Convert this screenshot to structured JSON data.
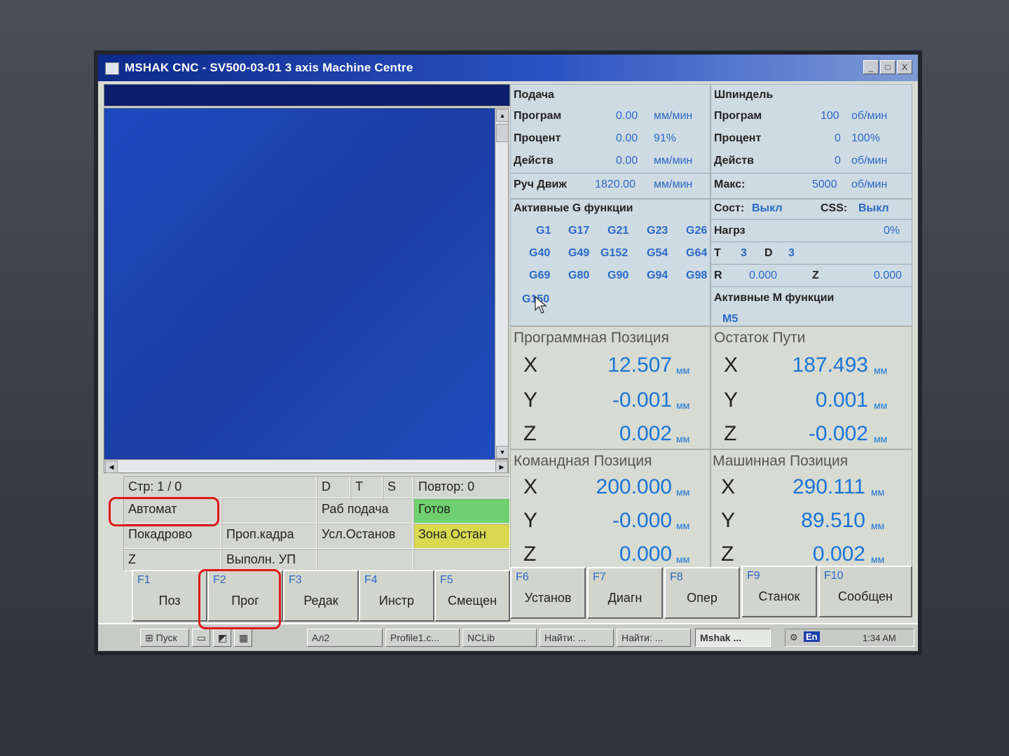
{
  "window": {
    "title": "MSHAK CNC - SV500-03-01 3 axis Machine Centre",
    "buttons": [
      "_",
      "□",
      "X"
    ]
  },
  "status": {
    "page": "Стр: 1 / 0",
    "d": "D",
    "t": "T",
    "s": "S",
    "repeat": "Повтор:  0",
    "mode": "Автомат",
    "feed_mode": "Раб подача",
    "ready": "Готов",
    "single_block": "Покадрово",
    "skip_block": "Проп.кадра",
    "optional_stop": "Усл.Останов",
    "zone_stop": "Зона Остан",
    "z": "Z",
    "run_program": "Выполн. УП"
  },
  "feed": {
    "title": "Подача",
    "rows": [
      {
        "label": "Програм",
        "value": "0.00",
        "unit": "мм/мин"
      },
      {
        "label": "Процент",
        "value": "0.00",
        "unit": "91%"
      },
      {
        "label": "Действ",
        "value": "0.00",
        "unit": "мм/мин"
      },
      {
        "label": "Руч Движ",
        "value": "1820.00",
        "unit": "мм/мин"
      }
    ]
  },
  "spindle": {
    "title": "Шпиндель",
    "rows": [
      {
        "label": "Програм",
        "value": "100",
        "unit": "об/мин"
      },
      {
        "label": "Процент",
        "value": "0",
        "unit": "100%"
      },
      {
        "label": "Действ",
        "value": "0",
        "unit": "об/мин"
      },
      {
        "label": "Макс:",
        "value": "5000",
        "unit": "об/мин"
      }
    ],
    "state_label": "Сост:",
    "state_value": "Выкл",
    "css_label": "CSS:",
    "css_value": "Выкл",
    "load_label": "Нагрз",
    "load_value": "0%",
    "t_label": "T",
    "t_value": "3",
    "d_label": "D",
    "d_value": "3",
    "r_label": "R",
    "r_value": "0.000",
    "z_label": "Z",
    "z_value": "0.000"
  },
  "gfunc": {
    "title": "Активные G функции",
    "codes": [
      "G1",
      "G17",
      "G21",
      "G23",
      "G26",
      "G40",
      "G49",
      "G152",
      "G54",
      "G64",
      "G69",
      "G80",
      "G90",
      "G94",
      "G98",
      "G150"
    ]
  },
  "mfunc": {
    "title": "Активные M функции",
    "codes": [
      "M5"
    ]
  },
  "positions": {
    "program": {
      "title": "Программная Позиция",
      "x": "12.507",
      "y": "-0.001",
      "z": "0.002"
    },
    "remaining": {
      "title": "Остаток Пути",
      "x": "187.493",
      "y": "0.001",
      "z": "-0.002"
    },
    "command": {
      "title": "Командная Позиция",
      "x": "200.000",
      "y": "-0.000",
      "z": "0.000"
    },
    "machine": {
      "title": "Машинная Позиция",
      "x": "290.111",
      "y": "89.510",
      "z": "0.002"
    },
    "unit": "мм",
    "axes": [
      "X",
      "Y",
      "Z"
    ]
  },
  "fkeys": [
    {
      "key": "F1",
      "label": "Поз"
    },
    {
      "key": "F2",
      "label": "Прог"
    },
    {
      "key": "F3",
      "label": "Редак"
    },
    {
      "key": "F4",
      "label": "Инстр"
    },
    {
      "key": "F5",
      "label": "Смещен"
    },
    {
      "key": "F6",
      "label": "Установ"
    },
    {
      "key": "F7",
      "label": "Диагн"
    },
    {
      "key": "F8",
      "label": "Опер"
    },
    {
      "key": "F9",
      "label": "Станок"
    },
    {
      "key": "F10",
      "label": "Сообщен"
    }
  ],
  "taskbar": {
    "start": "Пуск",
    "items": [
      "Ал2",
      "Profile1.c...",
      "NCLib",
      "Найти: ...",
      "Найти: ...",
      "Mshak ..."
    ],
    "lang": "En",
    "clock": "1:34 AM"
  },
  "colors": {
    "accent": "#2a69c7",
    "ready": "#6fd06f",
    "zone": "#d9d84f",
    "highlight": "#e01818"
  }
}
